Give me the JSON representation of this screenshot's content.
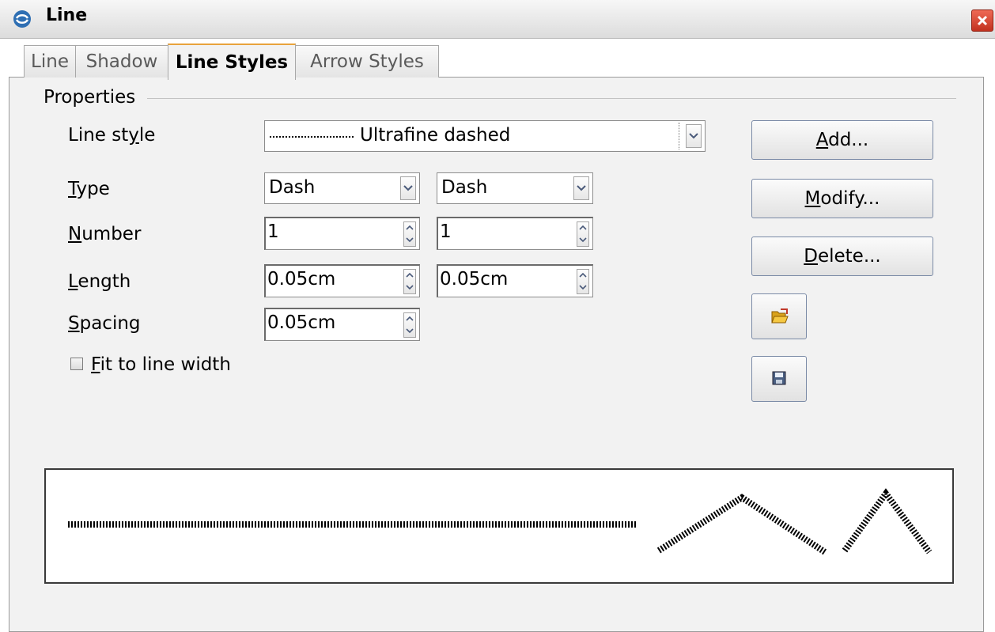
{
  "window": {
    "title": "Line"
  },
  "tabs": [
    {
      "label": "Line"
    },
    {
      "label": "Shadow"
    },
    {
      "label": "Line Styles"
    },
    {
      "label": "Arrow Styles"
    }
  ],
  "active_tab": "Line Styles",
  "properties": {
    "section_label": "Properties",
    "line_style": {
      "label_pre": "Line st",
      "label_mnemonic": "y",
      "label_post": "le",
      "value": "Ultrafine dashed"
    },
    "type": {
      "label_mnemonic": "T",
      "label_post": "ype",
      "value1": "Dash",
      "value2": "Dash"
    },
    "number": {
      "label_mnemonic": "N",
      "label_post": "umber",
      "value1": "1",
      "value2": "1"
    },
    "length": {
      "label_mnemonic": "L",
      "label_post": "ength",
      "value1": "0.05cm",
      "value2": "0.05cm"
    },
    "spacing": {
      "label_mnemonic": "S",
      "label_post": "pacing",
      "value": "0.05cm"
    },
    "fit_to_line_width": {
      "label_mnemonic": "F",
      "label_post": "it to line width",
      "checked": false
    }
  },
  "buttons": {
    "add": {
      "mnemonic": "A",
      "rest": "dd..."
    },
    "modify": {
      "mnemonic": "M",
      "rest": "odify..."
    },
    "delete": {
      "mnemonic": "D",
      "rest": "elete..."
    },
    "load_icon": "open-folder-icon",
    "save_icon": "floppy-disk-icon"
  },
  "colors": {
    "close_button": "#d9442e",
    "active_tab_accent": "#e8a33c",
    "button_border": "#7a8aa6"
  }
}
